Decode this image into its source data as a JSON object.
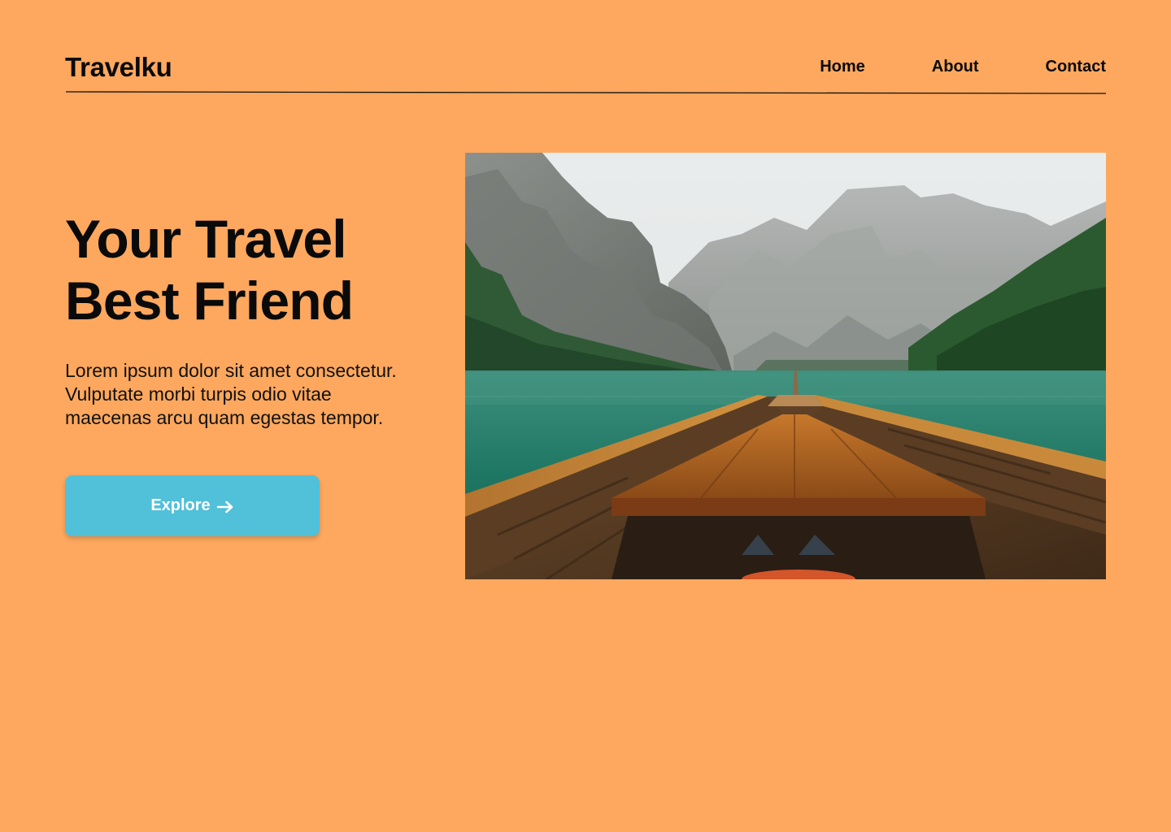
{
  "brand": {
    "name": "Travelku"
  },
  "nav": {
    "items": [
      {
        "label": "Home"
      },
      {
        "label": "About"
      },
      {
        "label": "Contact"
      }
    ]
  },
  "hero": {
    "title_line_1": "Your Travel",
    "title_line_2": "Best Friend",
    "body_lines": [
      "Lorem ipsum dolor sit amet consectetur.",
      "Vulputate morbi turpis odio vitae",
      "maecenas arcu quam egestas tempor."
    ],
    "cta": {
      "label": "Explore",
      "icon": "arrow-right-icon"
    },
    "image": {
      "subject": "wooden boat bow on a mountain lake"
    }
  },
  "colors": {
    "background": "#FDA85E",
    "button": "#51C0D9",
    "text": "#0A0A0A",
    "button_text": "#FFFFFF"
  }
}
